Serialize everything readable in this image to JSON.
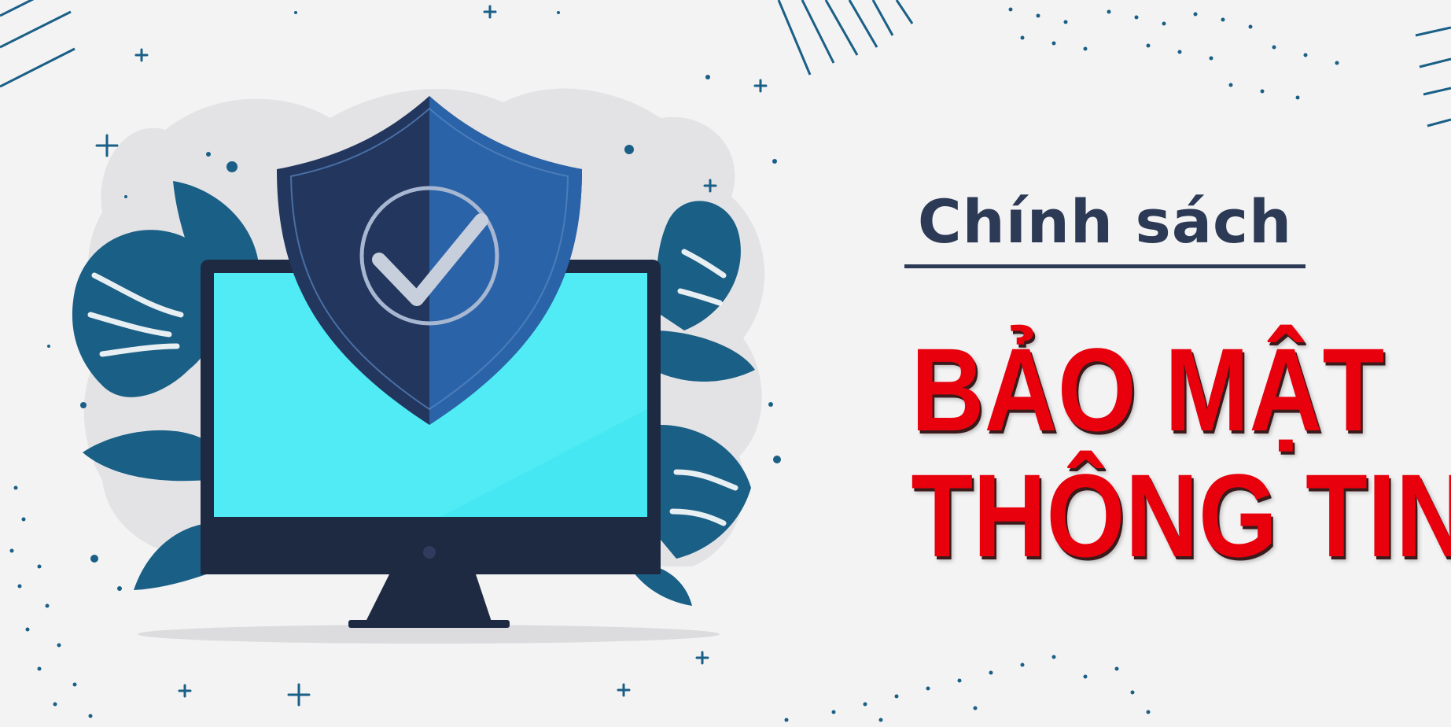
{
  "banner": {
    "subtitle": "Chính sách",
    "headline_line1": "BẢO MẬT",
    "headline_line2": "THÔNG TIN"
  },
  "colors": {
    "background": "#f3f3f4",
    "subtitle": "#2d3a55",
    "headline": "#e8000d",
    "leaf": "#1a5f86",
    "shield_dark": "#22365e",
    "shield_light": "#2a63a8",
    "screen": "#45e7f2",
    "monitor_frame": "#1e2942"
  },
  "illustration": {
    "icons": [
      "shield-icon",
      "checkmark-icon",
      "monitor-icon",
      "leaf-icon",
      "plus-icon",
      "dot-pattern"
    ]
  }
}
